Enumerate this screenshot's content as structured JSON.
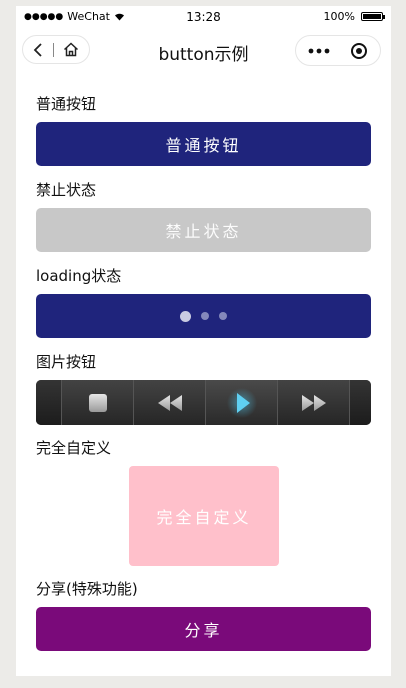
{
  "status_bar": {
    "signal": "●●●●●",
    "carrier": "WeChat",
    "wifi_icon": "wifi-icon",
    "time": "13:28",
    "battery_percent": "100%",
    "battery_level": 1.0
  },
  "nav_bar": {
    "title": "button示例",
    "back_icon": "chevron-left-icon",
    "home_icon": "home-icon",
    "more_icon": "more-dots-icon",
    "close_icon": "target-icon"
  },
  "sections": {
    "normal": {
      "label": "普通按钮",
      "button_label": "普通按钮"
    },
    "disabled": {
      "label": "禁止状态",
      "button_label": "禁止状态"
    },
    "loading": {
      "label": "loading状态"
    },
    "image": {
      "label": "图片按钮",
      "controls": [
        "stop-icon",
        "rewind-icon",
        "play-icon",
        "fast-forward-icon"
      ]
    },
    "custom": {
      "label": "完全自定义",
      "button_label": "完全自定义"
    },
    "share": {
      "label": "分享(特殊功能)",
      "button_label": "分享"
    }
  },
  "colors": {
    "primary": "#1f247c",
    "disabled": "#c8c8c8",
    "custom": "#ffc0cb",
    "share": "#7a0a7a",
    "play_accent": "#4fc3e8"
  }
}
